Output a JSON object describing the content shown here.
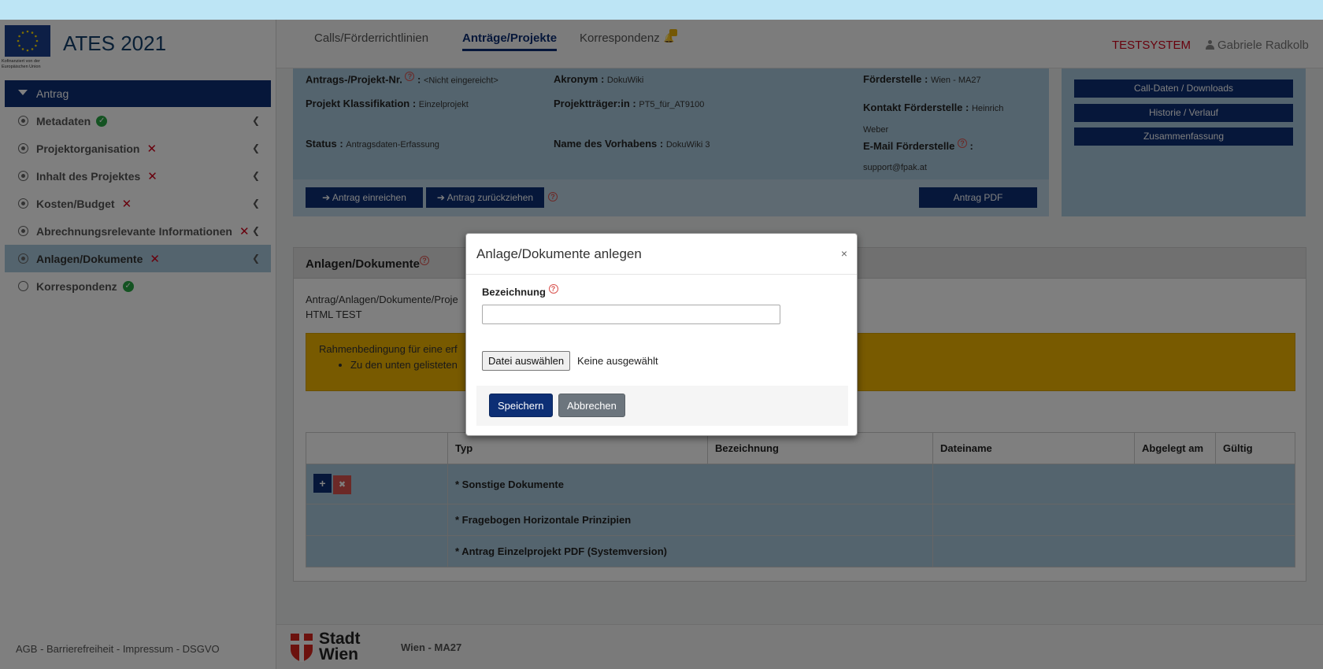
{
  "brand": {
    "title": "ATES 2021",
    "eu_caption": "Kofinanziert von der Europäischen Union"
  },
  "sidebar": {
    "header": "Antrag",
    "items": [
      {
        "label": "Metadaten",
        "status": "ok"
      },
      {
        "label": "Projektorganisation",
        "status": "error"
      },
      {
        "label": "Inhalt des Projektes",
        "status": "error"
      },
      {
        "label": "Kosten/Budget",
        "status": "error"
      },
      {
        "label": "Abrechnungsrelevante Informationen",
        "status": "error"
      },
      {
        "label": "Anlagen/Dokumente",
        "status": "error"
      },
      {
        "label": "Korrespondenz",
        "status": "ok"
      }
    ],
    "footer": "AGB - Barrierefreiheit - Impressum - DSGVO"
  },
  "topnav": {
    "tabs": [
      "Calls/Förderrichtlinien",
      "Anträge/Projekte",
      "Korrespondenz"
    ],
    "active_tab": "Anträge/Projekte",
    "env": "TESTSYSTEM",
    "user": "Gabriele Radkolb"
  },
  "info": {
    "antragsnr_label": "Antrags-/Projekt-Nr.",
    "antragsnr_value": "<Nicht eingereicht>",
    "akronym_label": "Akronym :",
    "akronym_value": "DokuWiki",
    "foerderstelle_label": "Förderstelle :",
    "foerderstelle_value": "Wien - MA27",
    "klassifikation_label": "Projekt Klassifikation :",
    "klassifikation_value": "Einzelprojekt",
    "traeger_label": "Projektträger:in :",
    "traeger_value": "PT5_für_AT9100",
    "kontakt_label": "Kontakt Förderstelle :",
    "kontakt_value_1": "Heinrich",
    "kontakt_value_2": "Weber",
    "status_label": "Status :",
    "status_value": "Antragsdaten-Erfassung",
    "vorhaben_label": "Name des Vorhabens :",
    "vorhaben_value": "DokuWiki 3",
    "email_label": "E-Mail Förderstelle",
    "email_value": "support@fpak.at",
    "btn_einreichen": "Antrag einreichen",
    "btn_zurueckziehen": "Antrag zurückziehen",
    "btn_pdf": "Antrag PDF"
  },
  "side_buttons": [
    "Call-Daten / Downloads",
    "Historie / Verlauf",
    "Zusammenfassung"
  ],
  "main": {
    "heading": "Anlagen/Dokumente",
    "path": "Antrag/Anlagen/Dokumente/Proje",
    "html_test": "HTML TEST",
    "notice_title": "Rahmenbedingung für eine erf",
    "notice_item": "Zu den unten gelisteten",
    "table": {
      "headers": [
        "",
        "Typ",
        "Bezeichnung",
        "Dateiname",
        "Abgelegt am",
        "Gültig"
      ],
      "rows": [
        "* Sonstige Dokumente",
        "* Fragebogen Horizontale Prinzipien",
        "* Antrag Einzelprojekt PDF (Systemversion)"
      ]
    }
  },
  "footer": {
    "logo_line1": "Stadt",
    "logo_line2": "Wien",
    "org": "Wien - MA27"
  },
  "modal": {
    "title": "Anlage/Dokumente anlegen",
    "close": "×",
    "label": "Bezeichnung",
    "input_value": "",
    "file_button": "Datei auswählen",
    "file_status": "Keine ausgewählt",
    "save": "Speichern",
    "cancel": "Abbrechen"
  },
  "colors": {
    "primary": "#0d2f75",
    "panel": "#a9c9dc",
    "notice": "#f0b400",
    "error": "#d0021b",
    "ok": "#28a745"
  }
}
